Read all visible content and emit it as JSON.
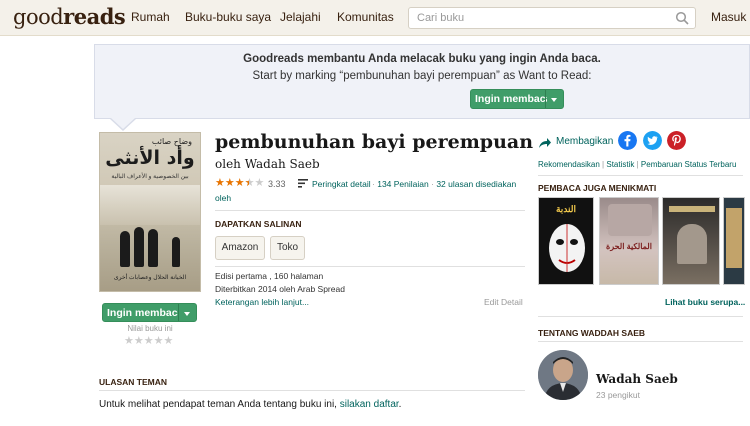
{
  "header": {
    "logo_light": "good",
    "logo_bold": "reads",
    "nav": [
      "Rumah",
      "Buku-buku saya",
      "Jelajahi",
      "Komunitas"
    ],
    "search_placeholder": "Cari buku",
    "login": "Masuk"
  },
  "banner": {
    "line1": "Goodreads membantu Anda melacak buku yang ingin Anda baca.",
    "line2": "Start by marking “pembunuhan bayi perempuan” as Want to Read:",
    "want_button": "Ingin membacanya"
  },
  "book": {
    "title": "pembunuhan bayi perempuan",
    "author_line": "oleh Wadah Saeb",
    "avg_rating": "3.33",
    "rating_value": 3.33,
    "rating_details": "Peringkat detail",
    "ratings_count": "134 Penilaian",
    "reviews_count": "32 ulasan disediakan",
    "reviews_suffix": "oleh",
    "get_copy": "DAPATKAN SALINAN",
    "stores": [
      "Amazon",
      "Toko"
    ],
    "edition_line1": "Edisi pertama , 160 halaman",
    "edition_line2": "Diterbitkan 2014 oleh Arab Spread",
    "more_details": "Keterangan lebih lanjut...",
    "edit_details": "Edit Detail",
    "cover_author": "وضاح صائب",
    "cover_title": "وأد الأنثى",
    "cover_subtitle": "بين الخصوصية و الأعراف البالية",
    "cover_bottom": "الخيانة الحلال وعصابات أخرى",
    "want_button": "Ingin membacanya",
    "rate_label": "Nilai buku ini"
  },
  "reviews": {
    "heading": "ULASAN TEMAN",
    "text": "Untuk melihat pendapat teman Anda tentang buku ini, ",
    "signup_link": "silakan daftar",
    "text_end": "."
  },
  "sidebar": {
    "share": "Membagikan",
    "links": [
      "Rekomendasikan",
      "Statistik",
      "Pembaruan Status Terbaru"
    ],
    "also_enjoyed": "PEMBACA JUGA MENIKMATI",
    "thumb1_title": "الندبة",
    "thumb2_title": "المالكية الحرة",
    "see_similar": "Lihat buku serupa...",
    "about_author": "TENTANG WADDAH SAEB",
    "author_name": "Wadah Saeb",
    "author_followers": "23 pengikut"
  },
  "colors": {
    "header_bg": "#f4f1ea",
    "brand_brown": "#382110",
    "link_green": "#00635d",
    "button_green": "#409d69",
    "star_orange": "#e87400",
    "facebook": "#1877f2",
    "twitter": "#1da1f2",
    "pinterest": "#cb2027"
  }
}
